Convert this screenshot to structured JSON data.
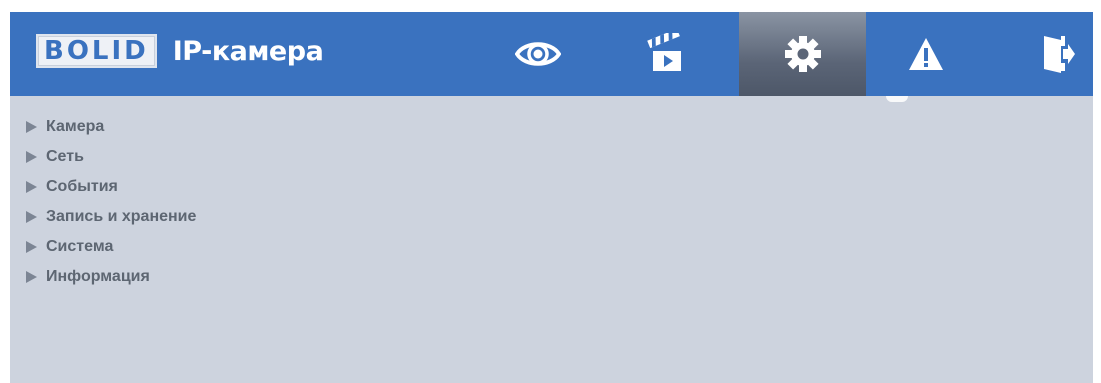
{
  "header": {
    "logo_text": "BOLID",
    "product_name": "IP-камера",
    "nav": [
      {
        "name": "live-view",
        "icon": "eye-icon"
      },
      {
        "name": "playback",
        "icon": "clapperboard-icon"
      },
      {
        "name": "settings",
        "icon": "gear-icon",
        "active": true
      },
      {
        "name": "alarm",
        "icon": "warning-icon"
      },
      {
        "name": "logout",
        "icon": "exit-door-icon"
      }
    ]
  },
  "menu": {
    "items": [
      {
        "label": "Камера"
      },
      {
        "label": "Сеть"
      },
      {
        "label": "События"
      },
      {
        "label": "Запись и хранение"
      },
      {
        "label": "Система"
      },
      {
        "label": "Информация"
      }
    ]
  },
  "colors": {
    "topbar": "#3a72bf",
    "content_bg": "#cdd3de",
    "menu_text": "#5d6672",
    "active_tab": "#5b6577"
  }
}
